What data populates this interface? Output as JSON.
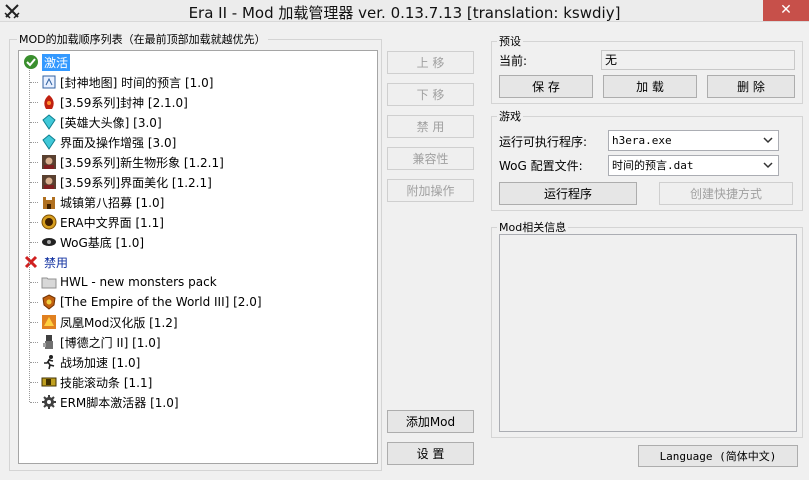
{
  "window": {
    "title": "Era II - Mod 加载管理器 ver. 0.13.7.13 [translation: kswdiy]",
    "close_glyph": "✕"
  },
  "mod_list": {
    "group_label": "MOD的加载顺序列表（在最前顶部加载就越优先）",
    "enabled_category": "激活",
    "disabled_category": "禁用",
    "enabled_items": [
      {
        "label": "[封神地图] 时间的预言 [1.0]",
        "icon": "map-scroll-icon"
      },
      {
        "label": "[3.59系列]封神 [2.1.0]",
        "icon": "red-creature-icon"
      },
      {
        "label": "[英雄大头像] [3.0]",
        "icon": "cyan-crystal-icon"
      },
      {
        "label": "界面及操作增强 [3.0]",
        "icon": "cyan-crystal-icon"
      },
      {
        "label": "[3.59系列]新生物形象 [1.2.1]",
        "icon": "portrait-icon"
      },
      {
        "label": "[3.59系列]界面美化 [1.2.1]",
        "icon": "portrait-icon"
      },
      {
        "label": "城镇第八招募 [1.0]",
        "icon": "castle-icon"
      },
      {
        "label": "ERA中文界面 [1.1]",
        "icon": "gold-coin-icon"
      },
      {
        "label": "WoG基底 [1.0]",
        "icon": "dark-eye-icon"
      }
    ],
    "disabled_items": [
      {
        "label": "HWL - new monsters pack",
        "icon": "folder-icon"
      },
      {
        "label": "[The Empire of the World III] [2.0]",
        "icon": "crest-icon"
      },
      {
        "label": "凤凰Mod汉化版 [1.2]",
        "icon": "phoenix-icon"
      },
      {
        "label": "[博德之门 II] [1.0]",
        "icon": "knight-icon"
      },
      {
        "label": "战场加速 [1.0]",
        "icon": "runner-icon"
      },
      {
        "label": "技能滚动条 [1.1]",
        "icon": "scrollbar-icon"
      },
      {
        "label": "ERM脚本激活器 [1.0]",
        "icon": "gear-icon"
      }
    ]
  },
  "side_buttons": {
    "move_up": "上 移",
    "move_down": "下 移",
    "disable": "禁 用",
    "compatibility": "兼容性",
    "extra_ops": "附加操作",
    "add_mod": "添加Mod",
    "settings": "设 置"
  },
  "preset": {
    "group_label": "预设",
    "current_label": "当前:",
    "current_value": "无",
    "save": "保 存",
    "load": "加 载",
    "delete": "删 除"
  },
  "game": {
    "group_label": "游戏",
    "exe_label": "运行可执行程序:",
    "exe_value": "h3era.exe",
    "wog_label": "WoG 配置文件:",
    "wog_value": "时间的预言.dat",
    "run": "运行程序",
    "shortcut": "创建快捷方式"
  },
  "mod_info": {
    "group_label": "Mod相关信息",
    "content": ""
  },
  "language_button": "Language (简体中文)"
}
